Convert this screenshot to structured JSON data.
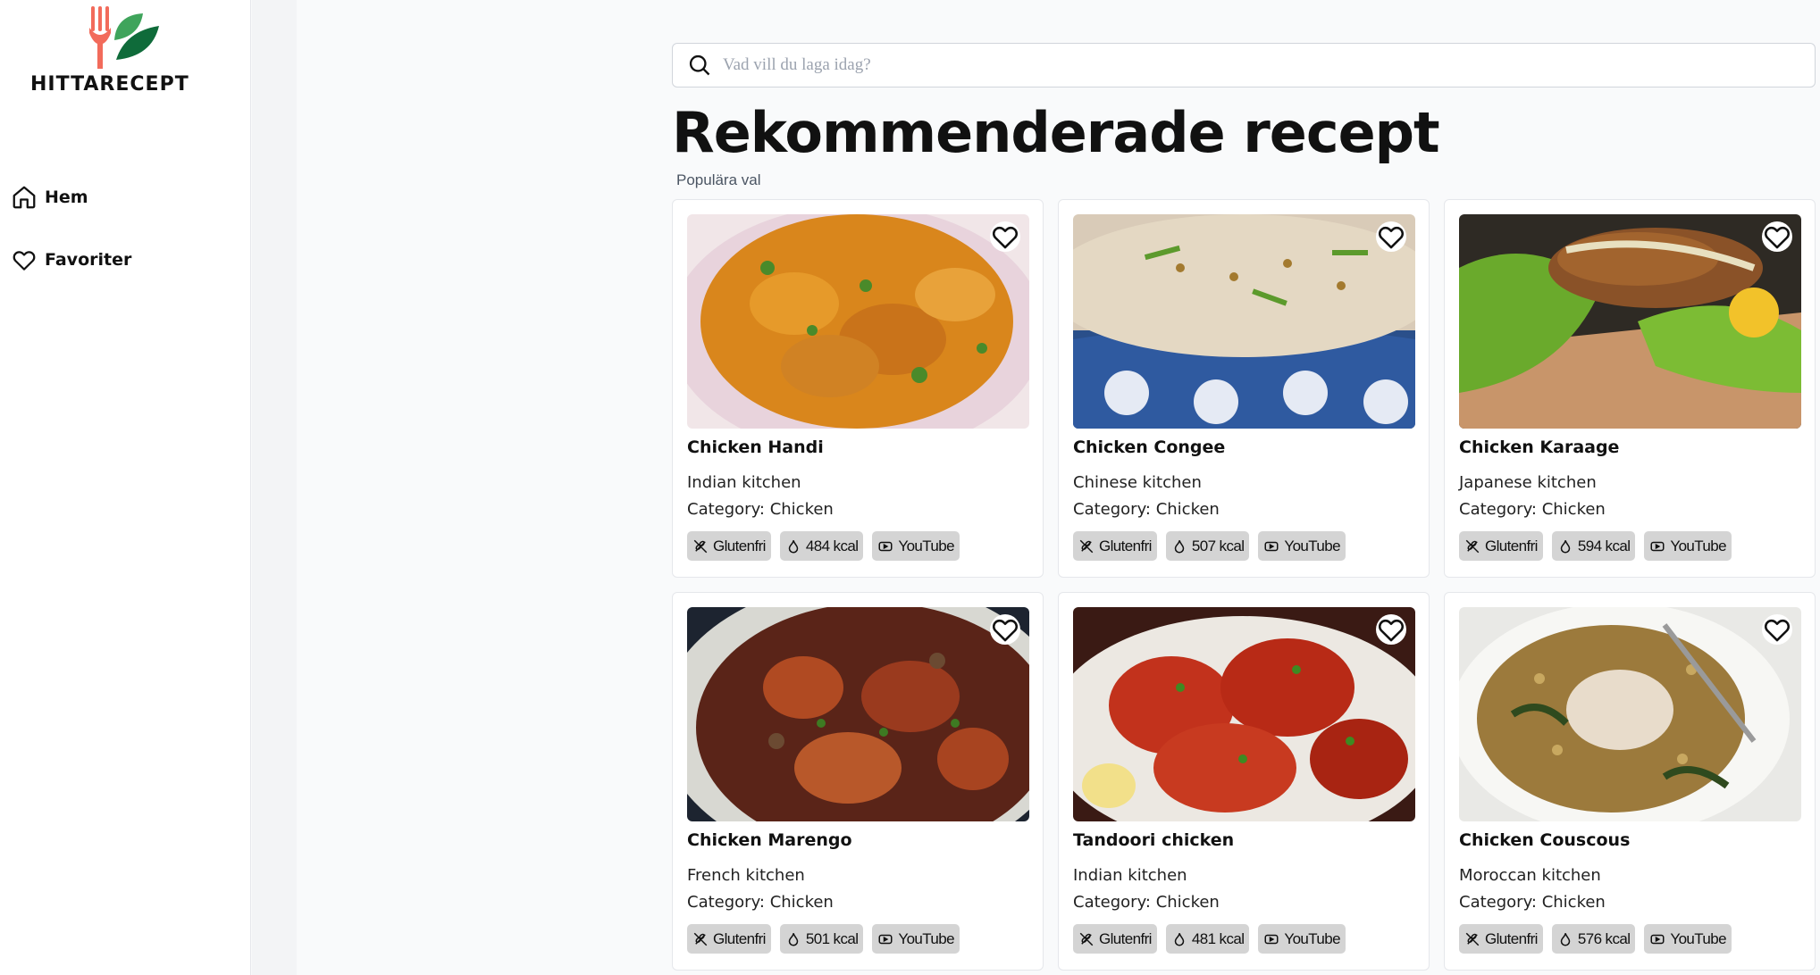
{
  "app": {
    "logo_text": "HITTARECEPT",
    "accent_colors": {
      "fork": "#f26b5b",
      "leaf_dark": "#0f6b3a",
      "leaf_light": "#3fa45b"
    }
  },
  "sidebar": {
    "items": [
      {
        "label": "Hem",
        "icon": "home-icon"
      },
      {
        "label": "Favoriter",
        "icon": "heart-icon"
      }
    ]
  },
  "search": {
    "placeholder": "Vad vill du laga idag?",
    "value": "",
    "icon": "search-icon"
  },
  "main": {
    "title": "Rekommenderade recept",
    "subtitle": "Populära val",
    "cards": [
      {
        "title": "Chicken Handi",
        "kitchen": "Indian kitchen",
        "category": "Category: Chicken",
        "tags": {
          "gluten": "Glutenfri",
          "kcal": "484 kcal",
          "video": "YouTube"
        },
        "image": "chicken-handi-photo"
      },
      {
        "title": "Chicken Congee",
        "kitchen": "Chinese kitchen",
        "category": "Category: Chicken",
        "tags": {
          "gluten": "Glutenfri",
          "kcal": "507 kcal",
          "video": "YouTube"
        },
        "image": "chicken-congee-photo"
      },
      {
        "title": "Chicken Karaage",
        "kitchen": "Japanese kitchen",
        "category": "Category: Chicken",
        "tags": {
          "gluten": "Glutenfri",
          "kcal": "594 kcal",
          "video": "YouTube"
        },
        "image": "chicken-karaage-photo"
      },
      {
        "title": "Chicken Marengo",
        "kitchen": "French kitchen",
        "category": "Category: Chicken",
        "tags": {
          "gluten": "Glutenfri",
          "kcal": "501 kcal",
          "video": "YouTube"
        },
        "image": "chicken-marengo-photo"
      },
      {
        "title": "Tandoori chicken",
        "kitchen": "Indian kitchen",
        "category": "Category: Chicken",
        "tags": {
          "gluten": "Glutenfri",
          "kcal": "481 kcal",
          "video": "YouTube"
        },
        "image": "tandoori-chicken-photo"
      },
      {
        "title": "Chicken Couscous",
        "kitchen": "Moroccan kitchen",
        "category": "Category: Chicken",
        "tags": {
          "gluten": "Glutenfri",
          "kcal": "576 kcal",
          "video": "YouTube"
        },
        "image": "chicken-couscous-photo"
      }
    ]
  }
}
